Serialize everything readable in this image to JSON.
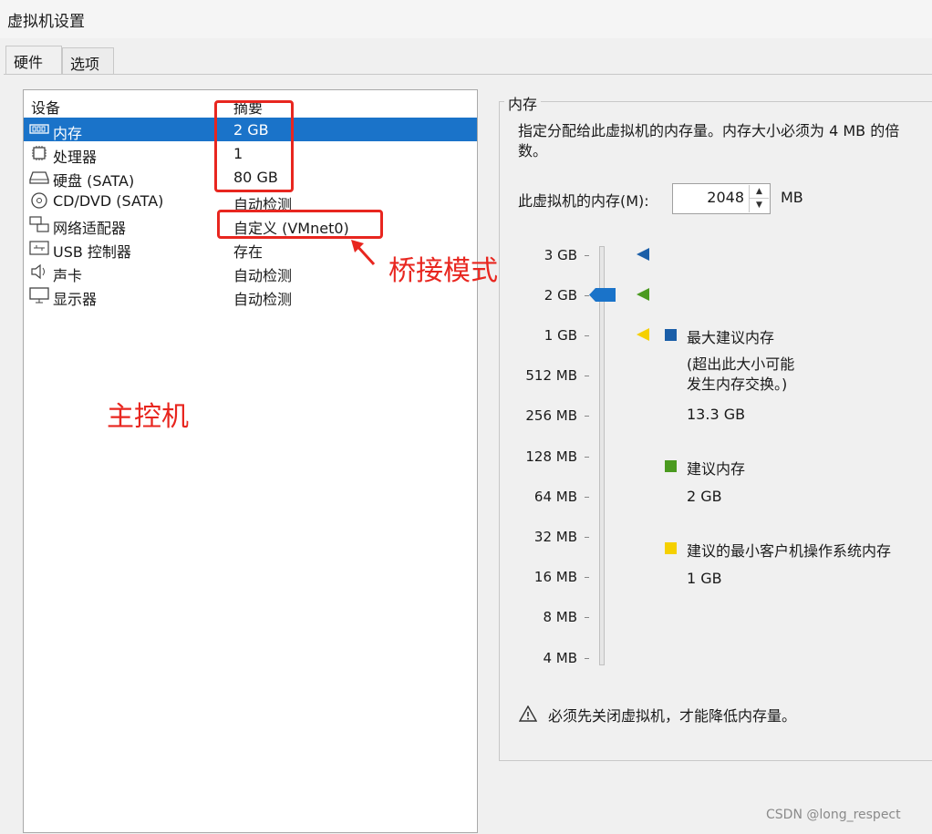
{
  "window": {
    "title": "虚拟机设置"
  },
  "tabs": [
    {
      "label": "硬件",
      "active": true
    },
    {
      "label": "选项",
      "active": false
    }
  ],
  "device_list": {
    "headers": {
      "device": "设备",
      "summary": "摘要"
    },
    "rows": [
      {
        "icon": "memory-icon",
        "name": "内存",
        "summary": "2 GB",
        "selected": true
      },
      {
        "icon": "processor-icon",
        "name": "处理器",
        "summary": "1"
      },
      {
        "icon": "hard-disk-icon",
        "name": "硬盘 (SATA)",
        "summary": "80 GB"
      },
      {
        "icon": "cd-dvd-icon",
        "name": "CD/DVD (SATA)",
        "summary": "自动检测"
      },
      {
        "icon": "network-adapter-icon",
        "name": "网络适配器",
        "summary": "自定义 (VMnet0)"
      },
      {
        "icon": "usb-icon",
        "name": "USB 控制器",
        "summary": "存在"
      },
      {
        "icon": "sound-card-icon",
        "name": "声卡",
        "summary": "自动检测"
      },
      {
        "icon": "display-icon",
        "name": "显示器",
        "summary": "自动检测"
      }
    ]
  },
  "annotations": {
    "bridge_mode": "桥接模式",
    "host": "主控机",
    "color": "#e8261f"
  },
  "memory": {
    "group_label": "内存",
    "description": "指定分配给此虚拟机的内存量。内存大小必须为 4 MB 的倍数。",
    "input_label": "此虚拟机的内存(M):",
    "value": "2048",
    "unit": "MB",
    "scale_labels": [
      "3 GB",
      "2 GB",
      "1 GB",
      "512 MB",
      "256 MB",
      "128 MB",
      "64 MB",
      "32 MB",
      "16 MB",
      "8 MB",
      "4 MB"
    ],
    "legend": {
      "max": {
        "title": "最大建议内存",
        "note_line1": "(超出此大小可能",
        "note_line2": "发生内存交换。)",
        "value": "13.3 GB",
        "color": "#1a5ea8"
      },
      "recommended": {
        "title": "建议内存",
        "value": "2 GB",
        "color": "#4a9a1f"
      },
      "minimum": {
        "title": "建议的最小客户机操作系统内存",
        "value": "1 GB",
        "color": "#f5d000"
      }
    },
    "warning": "必须先关闭虚拟机，才能降低内存量。"
  },
  "watermark": "CSDN @long_respect"
}
